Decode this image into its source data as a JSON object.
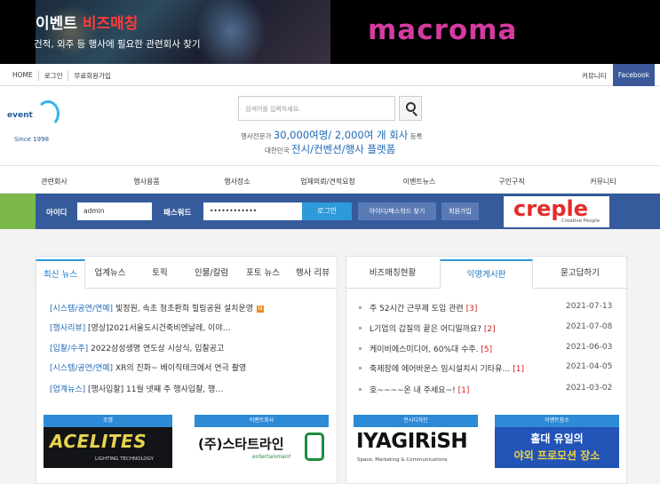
{
  "banner": {
    "left_title_a": "이벤트",
    "left_title_b": "비즈매칭",
    "left_sub": "건적, 외주 등 행사에 필요한 관련회사 찾기",
    "right_brand": "macroma"
  },
  "topnav": {
    "items": [
      "HOME",
      "로그인",
      "무료회원가입"
    ],
    "community": "커뮤니티",
    "facebook": "Facebook"
  },
  "logo": {
    "text": "event",
    "since": "Since 1998"
  },
  "search": {
    "placeholder": "검색어를 입력하세요."
  },
  "stats": {
    "l1_a": "행사전문가",
    "l1_big": "30,000여명/ 2,000여 개 회사",
    "l1_b": "등록",
    "l2_a": "대한민국",
    "l2_big": "전시/컨벤션/행사 플랫폼"
  },
  "mainnav": [
    "관련회사",
    "행사용품",
    "행사장소",
    "업체의뢰/견적요청",
    "이벤트뉴스",
    "구인구직",
    "커뮤니티"
  ],
  "login": {
    "id_label": "아이디",
    "id_value": "admin",
    "pw_label": "패스워드",
    "pw_value": "••••••••••••",
    "login_button": "로그인",
    "find_button": "아이디/패스워드 찾기",
    "join_button": "회원가입",
    "ad_brand": "creple",
    "ad_sub": "Creative People"
  },
  "news": {
    "tabs": [
      "최신 뉴스",
      "업계뉴스",
      "토픽",
      "인물/칼럼",
      "포토 뉴스",
      "행사 리뷰"
    ],
    "items": [
      {
        "cat": "[시스템/공연/연예]",
        "title": "빛정원, 속초 청초환희 힐링공원 설치운영",
        "badge": "N"
      },
      {
        "cat": "[행사리뷰]",
        "title": "[영상]2021서울도시건축비엔날레, 이야…",
        "badge": ""
      },
      {
        "cat": "[입찰/수주]",
        "title": "2022삼성생명 연도상 시상식, 입찰공고",
        "badge": ""
      },
      {
        "cat": "[시스템/공연/연예]",
        "title": "XR의 진화~ 베이직테크에서 연극 촬영",
        "badge": ""
      },
      {
        "cat": "[업계뉴스]",
        "title": "[행사입찰] 11월 넷째 주 행사입찰, 행…",
        "badge": ""
      }
    ],
    "cards": [
      {
        "label": "조명",
        "brand": "ACELITES",
        "sub": "LIGHTING TECHNOLOGY"
      },
      {
        "label": "이벤트회사",
        "brand": "(주)스타트라인",
        "sub": "entertainment"
      }
    ]
  },
  "board": {
    "tabs": [
      "비즈매칭현황",
      "익명게시판",
      "묻고답하기"
    ],
    "posts": [
      {
        "title": "주 52시간 근무제 도입 관련",
        "count": "[3]",
        "date": "2021-07-13"
      },
      {
        "title": "L기업의 갑질의 끝은 어디일까요?",
        "count": "[2]",
        "date": "2021-07-08"
      },
      {
        "title": "케이비에스미디어, 60%대 수주.",
        "count": "[5]",
        "date": "2021-06-03"
      },
      {
        "title": "축제장에 에어바운스 임시설치시 기타유…",
        "count": "[1]",
        "date": "2021-04-05"
      },
      {
        "title": "호~~~~온 내 주세요~!",
        "count": "[1]",
        "date": "2021-03-02"
      }
    ],
    "cards": [
      {
        "label": "전시디자인",
        "brand": "IYAGIRiSH",
        "sub": "Space, Marketing & Communications"
      },
      {
        "label": "이벤트장소",
        "brand1": "홀대 유일의",
        "brand2": "야외 프로모션 장소"
      }
    ]
  }
}
